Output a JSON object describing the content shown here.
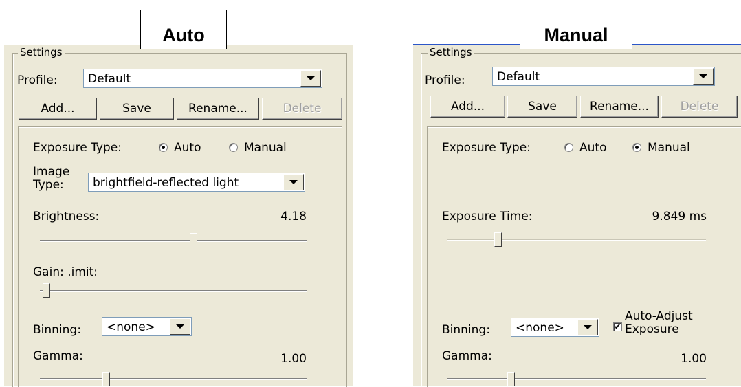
{
  "auto_panel": {
    "tag": "Auto",
    "group_label": "Settings",
    "profile_label": "Profile:",
    "profile_value": "Default",
    "buttons": {
      "add": "Add...",
      "save": "Save",
      "rename": "Rename...",
      "delete": "Delete"
    },
    "exposure_type_label": "Exposure Type:",
    "radio_auto": "Auto",
    "radio_manual": "Manual",
    "selected_mode": "Auto",
    "image_type_label_line1": "Image",
    "image_type_label_line2": "Type:",
    "image_type_value": "brightfield-reflected light",
    "brightness_label": "Brightness:",
    "brightness_value": "4.18",
    "gain_limit_label": "Gain: .imit:",
    "binning_label": "Binning:",
    "binning_value": "<none>",
    "gamma_label": "Gamma:",
    "gamma_value": "1.00"
  },
  "manual_panel": {
    "tag": "Manual",
    "group_label": "Settings",
    "profile_label": "Profile:",
    "profile_value": "Default",
    "buttons": {
      "add": "Add...",
      "save": "Save",
      "rename": "Rename...",
      "delete": "Delete"
    },
    "exposure_type_label": "Exposure Type:",
    "radio_auto": "Auto",
    "radio_manual": "Manual",
    "selected_mode": "Manual",
    "exposure_time_label": "Exposure Time:",
    "exposure_time_value": "9.849 ms",
    "binning_label": "Binning:",
    "binning_value": "<none>",
    "auto_adjust_line1": "Auto-Adjust",
    "auto_adjust_line2": "Exposure",
    "auto_adjust_checked": true,
    "gamma_label": "Gamma:",
    "gamma_value": "1.00"
  },
  "colors": {
    "panel_bg": "#ece9d8",
    "border": "#a9a694",
    "accent_line": "#2c56c8"
  }
}
